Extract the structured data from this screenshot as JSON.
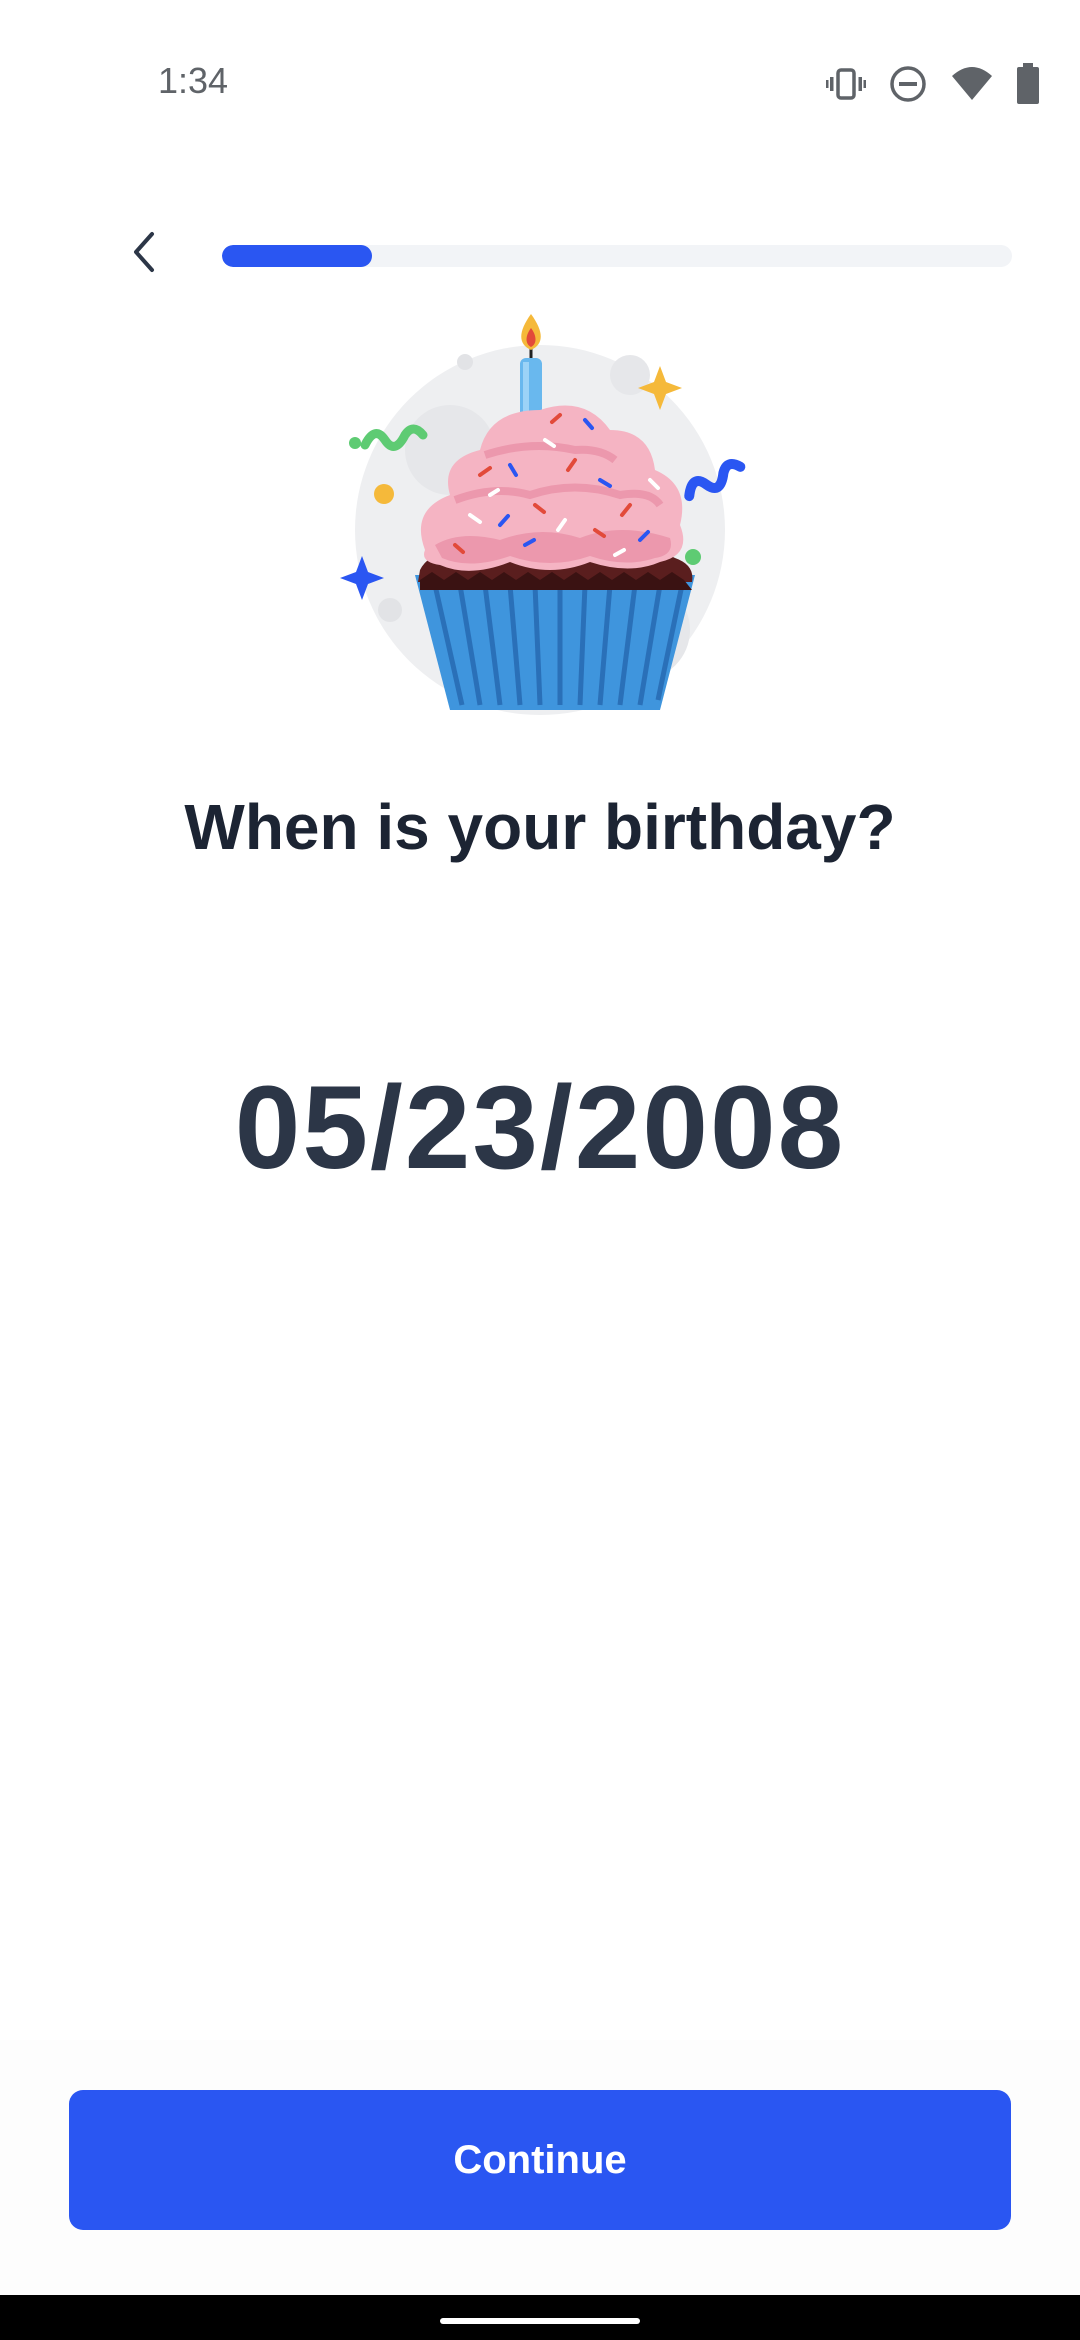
{
  "status_bar": {
    "time": "1:34",
    "icons": [
      "vibrate-icon",
      "do-not-disturb-icon",
      "wifi-icon",
      "battery-icon"
    ]
  },
  "header": {
    "back_icon": "chevron-left-icon",
    "progress_fraction": 0.19
  },
  "illustration": {
    "name": "birthday-cupcake-illustration"
  },
  "main": {
    "question": "When is your birthday?",
    "date_value": "05/23/2008"
  },
  "footer": {
    "continue_label": "Continue"
  },
  "colors": {
    "accent": "#2a56f2",
    "heading": "#1c2433",
    "date": "#2c3647",
    "track": "#f2f4f7"
  }
}
